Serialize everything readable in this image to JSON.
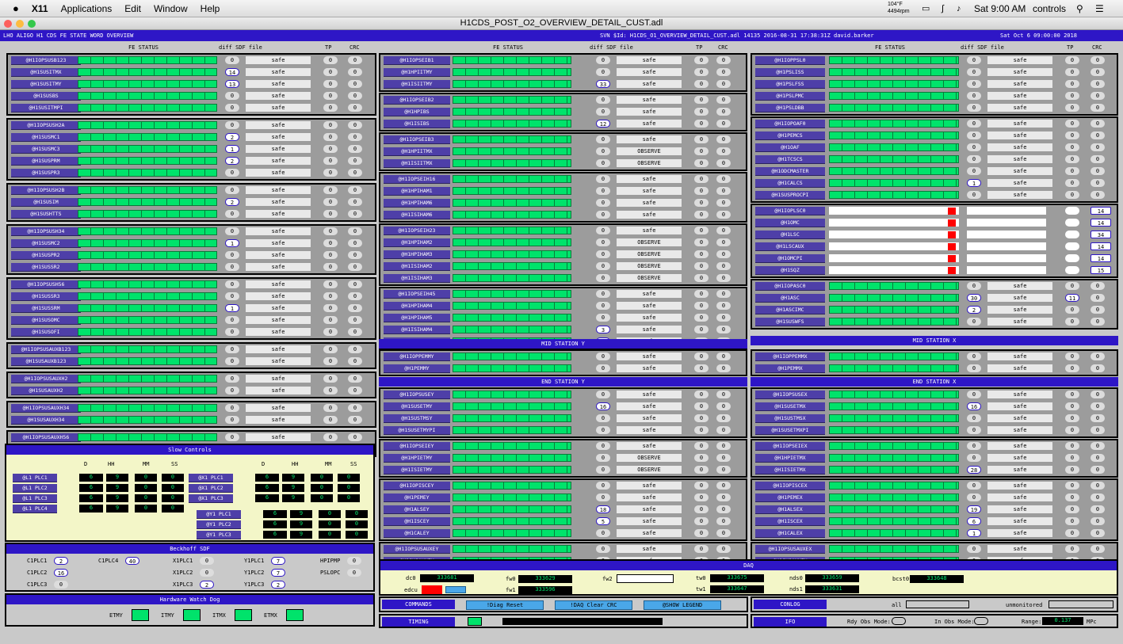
{
  "mac": {
    "apple": "",
    "app": "X11",
    "menus": [
      "Applications",
      "Edit",
      "Window",
      "Help"
    ],
    "temp": "104°F",
    "rpm": "4494rpm",
    "clock": "Sat 9:00 AM",
    "user": "controls"
  },
  "window": {
    "title": "H1CDS_POST_O2_OVERVIEW_DETAIL_CUST.adl"
  },
  "header": {
    "left": "LHO ALIGO H1 CDS FE STATE WORD OVERVIEW",
    "svn": "SVN $Id: H1CDS_O1_OVERVIEW_DETAIL_CUST.adl 14135 2016-08-31 17:38:31Z david.barker",
    "date": "Sat Oct  6 09:00:00 2018"
  },
  "cols": {
    "fe": "FE STATUS",
    "diff": "diff",
    "sdf": "SDF file",
    "tp": "TP",
    "crc": "CRC"
  },
  "left_blocks": [
    {
      "rows": [
        [
          "@H1IOPSUSB123",
          "0",
          "safe",
          "0",
          "0"
        ],
        [
          "@H1SUSITMX",
          "14",
          "safe",
          "0",
          "0"
        ],
        [
          "@H1SUSITMY",
          "13",
          "safe",
          "0",
          "0"
        ],
        [
          "@H1SUSBS",
          "0",
          "safe",
          "0",
          "0"
        ],
        [
          "@H1SUSITMPI",
          "0",
          "safe",
          "0",
          "0"
        ]
      ]
    },
    {
      "rows": [
        [
          "@H1IOPSUSH2A",
          "0",
          "safe",
          "0",
          "0"
        ],
        [
          "@H1SUSMC1",
          "2",
          "safe",
          "0",
          "0"
        ],
        [
          "@H1SUSMC3",
          "1",
          "safe",
          "0",
          "0"
        ],
        [
          "@H1SUSPRM",
          "2",
          "safe",
          "0",
          "0"
        ],
        [
          "@H1SUSPR3",
          "0",
          "safe",
          "0",
          "0"
        ]
      ]
    },
    {
      "rows": [
        [
          "@H1IOPSUSH2B",
          "0",
          "safe",
          "0",
          "0"
        ],
        [
          "@H1SUSIM",
          "2",
          "safe",
          "0",
          "0"
        ],
        [
          "@H1SUSHTTS",
          "0",
          "safe",
          "0",
          "0"
        ]
      ]
    },
    {
      "rows": [
        [
          "@H1IOPSUSH34",
          "0",
          "safe",
          "0",
          "0"
        ],
        [
          "@H1SUSMC2",
          "1",
          "safe",
          "0",
          "0"
        ],
        [
          "@H1SUSPR2",
          "0",
          "safe",
          "0",
          "0"
        ],
        [
          "@H1SUSSR2",
          "0",
          "safe",
          "0",
          "0"
        ]
      ]
    },
    {
      "rows": [
        [
          "@H1IOPSUSH56",
          "0",
          "safe",
          "0",
          "0"
        ],
        [
          "@H1SUSSR3",
          "0",
          "safe",
          "0",
          "0"
        ],
        [
          "@H1SUSSRM",
          "1",
          "safe",
          "0",
          "0"
        ],
        [
          "@H1SUSOMC",
          "0",
          "safe",
          "0",
          "0"
        ],
        [
          "@H1SUSOFI",
          "0",
          "safe",
          "0",
          "0"
        ]
      ]
    },
    {
      "rows": [
        [
          "@H1IOPSUSAUXB123",
          "0",
          "safe",
          "0",
          "0"
        ],
        [
          "@H1SUSAUXB123",
          "0",
          "safe",
          "0",
          "0"
        ]
      ]
    },
    {
      "rows": [
        [
          "@H1IOPSUSAUXH2",
          "0",
          "safe",
          "0",
          "0"
        ],
        [
          "@H1SUSAUXH2",
          "0",
          "safe",
          "0",
          "0"
        ]
      ]
    },
    {
      "rows": [
        [
          "@H1IOPSUSAUXH34",
          "0",
          "safe",
          "0",
          "0"
        ],
        [
          "@H1SUSAUXH34",
          "0",
          "safe",
          "0",
          "0"
        ]
      ]
    },
    {
      "rows": [
        [
          "@H1IOPSUSAUXH56",
          "0",
          "safe",
          "0",
          "0"
        ],
        [
          "@H1SUSAUXH56",
          "0",
          "safe",
          "0",
          "0"
        ]
      ]
    }
  ],
  "mid_blocks": [
    {
      "rows": [
        [
          "@H1IOPSEIB1",
          "0",
          "safe",
          "0",
          "0"
        ],
        [
          "@H1HPIITMY",
          "0",
          "safe",
          "0",
          "0"
        ],
        [
          "@H1ISIITMY",
          "33",
          "safe",
          "0",
          "0"
        ]
      ]
    },
    {
      "rows": [
        [
          "@H1IOPSEIB2",
          "0",
          "safe",
          "0",
          "0"
        ],
        [
          "@H1HPIBS",
          "0",
          "safe",
          "0",
          "0"
        ],
        [
          "@H1ISIBS",
          "12",
          "safe",
          "0",
          "0"
        ]
      ]
    },
    {
      "rows": [
        [
          "@H1IOPSEIB3",
          "0",
          "safe",
          "0",
          "0"
        ],
        [
          "@H1HPIITMX",
          "0",
          "OBSERVE",
          "0",
          "0"
        ],
        [
          "@H1ISIITMX",
          "0",
          "OBSERVE",
          "0",
          "0"
        ]
      ]
    },
    {
      "rows": [
        [
          "@H1IOPSEIH16",
          "0",
          "safe",
          "0",
          "0"
        ],
        [
          "@H1HPIHAM1",
          "0",
          "safe",
          "0",
          "0"
        ],
        [
          "@H1HPIHAM6",
          "0",
          "safe",
          "0",
          "0"
        ],
        [
          "@H1ISIHAM6",
          "0",
          "safe",
          "0",
          "0"
        ]
      ]
    },
    {
      "rows": [
        [
          "@H1IOPSEIH23",
          "0",
          "safe",
          "0",
          "0"
        ],
        [
          "@H1HPIHAM2",
          "0",
          "OBSERVE",
          "0",
          "0"
        ],
        [
          "@H1HPIHAM3",
          "0",
          "OBSERVE",
          "0",
          "0"
        ],
        [
          "@H1ISIHAM2",
          "0",
          "OBSERVE",
          "0",
          "0"
        ],
        [
          "@H1ISIHAM3",
          "0",
          "OBSERVE",
          "0",
          "0"
        ]
      ]
    },
    {
      "rows": [
        [
          "@H1IOPSEIH45",
          "0",
          "safe",
          "0",
          "0"
        ],
        [
          "@H1HPIHAM4",
          "0",
          "safe",
          "0",
          "0"
        ],
        [
          "@H1HPIHAM5",
          "0",
          "safe",
          "0",
          "0"
        ],
        [
          "@H1ISIHAM4",
          "3",
          "safe",
          "0",
          "0"
        ],
        [
          "@H1ISIHAM5",
          "5",
          "safe",
          "0",
          "0"
        ]
      ]
    }
  ],
  "right_blocks": [
    {
      "rows": [
        [
          "@H1IOPPSL0",
          "0",
          "safe",
          "0",
          "0"
        ],
        [
          "@H1PSLISS",
          "0",
          "safe",
          "0",
          "0"
        ],
        [
          "@H1PSLFSS",
          "0",
          "safe",
          "0",
          "0"
        ],
        [
          "@H1PSLPMC",
          "0",
          "safe",
          "0",
          "0"
        ],
        [
          "@H1PSLDBB",
          "0",
          "safe",
          "0",
          "0"
        ]
      ]
    },
    {
      "rows": [
        [
          "@H1IOPOAF0",
          "0",
          "safe",
          "0",
          "0"
        ],
        [
          "@H1PEMCS",
          "0",
          "safe",
          "0",
          "0"
        ],
        [
          "@H1OAF",
          "0",
          "safe",
          "0",
          "0"
        ],
        [
          "@H1TCSCS",
          "0",
          "safe",
          "0",
          "0"
        ],
        [
          "@H1ODCMASTER",
          "0",
          "safe",
          "0",
          "0"
        ],
        [
          "@H1CALCS",
          "1",
          "safe",
          "0",
          "0"
        ],
        [
          "@H1SUSPROCPI",
          "0",
          "safe",
          "0",
          "0"
        ]
      ]
    },
    {
      "rows": [
        [
          "@H1IOPLSC0",
          "",
          "",
          "",
          "14"
        ],
        [
          "@H1OMC",
          "",
          "",
          "",
          "14"
        ],
        [
          "@H1LSC",
          "",
          "",
          "",
          "34"
        ],
        [
          "@H1LSCAUX",
          "",
          "",
          "",
          "14"
        ],
        [
          "@H1OMCPI",
          "",
          "",
          "",
          "14"
        ],
        [
          "@H1SQZ",
          "",
          "",
          "",
          "15"
        ]
      ]
    },
    {
      "rows": [
        [
          "@H1IOPASC0",
          "0",
          "safe",
          "0",
          "0"
        ],
        [
          "@H1ASC",
          "30",
          "safe",
          "11",
          "0"
        ],
        [
          "@H1ASCIMC",
          "2",
          "safe",
          "0",
          "0"
        ],
        [
          "@H1SUSWFS",
          "0",
          "safe",
          "0",
          "0"
        ]
      ]
    }
  ],
  "mid_y": {
    "title": "MID STATION Y",
    "rows": [
      [
        "@H1IOPPEMMY",
        "0",
        "safe",
        "0",
        "0"
      ],
      [
        "@H1PEMMY",
        "0",
        "safe",
        "0",
        "0"
      ]
    ]
  },
  "mid_x": {
    "title": "MID STATION X",
    "rows": [
      [
        "@H1IOPPEMMX",
        "0",
        "safe",
        "0",
        "0"
      ],
      [
        "@H1PEMMX",
        "0",
        "safe",
        "0",
        "0"
      ]
    ]
  },
  "end_y": {
    "title": "END STATION Y",
    "blocks": [
      {
        "rows": [
          [
            "@H1IOPSUSEY",
            "0",
            "safe",
            "0",
            "0"
          ],
          [
            "@H1SUSETMY",
            "16",
            "safe",
            "0",
            "0"
          ],
          [
            "@H1SUSTMSY",
            "0",
            "safe",
            "0",
            "0"
          ],
          [
            "@H1SUSETMYPI",
            "0",
            "safe",
            "0",
            "0"
          ]
        ]
      },
      {
        "rows": [
          [
            "@H1IOPSEIEY",
            "0",
            "safe",
            "0",
            "0"
          ],
          [
            "@H1HPIETMY",
            "0",
            "OBSERVE",
            "0",
            "0"
          ],
          [
            "@H1ISIETMY",
            "0",
            "OBSERVE",
            "0",
            "0"
          ]
        ]
      },
      {
        "rows": [
          [
            "@H1IOPISCEY",
            "0",
            "safe",
            "0",
            "0"
          ],
          [
            "@H1PEMEY",
            "0",
            "safe",
            "0",
            "0"
          ],
          [
            "@H1ALSEY",
            "18",
            "safe",
            "0",
            "0"
          ],
          [
            "@H1ISCEY",
            "5",
            "safe",
            "0",
            "0"
          ],
          [
            "@H1CALEY",
            "0",
            "safe",
            "0",
            "0"
          ]
        ]
      },
      {
        "rows": [
          [
            "@H1IOPSUSAUXEY",
            "0",
            "safe",
            "0",
            "0"
          ],
          [
            "@H1SUSAUXEY",
            "0",
            "safe",
            "0",
            "0"
          ]
        ]
      }
    ]
  },
  "end_x": {
    "title": "END STATION X",
    "blocks": [
      {
        "rows": [
          [
            "@H1IOPSUSEX",
            "0",
            "safe",
            "0",
            "0"
          ],
          [
            "@H1SUSETMX",
            "16",
            "safe",
            "0",
            "0"
          ],
          [
            "@H1SUSTMSX",
            "0",
            "safe",
            "0",
            "0"
          ],
          [
            "@H1SUSETMXPI",
            "0",
            "safe",
            "0",
            "0"
          ]
        ]
      },
      {
        "rows": [
          [
            "@H1IOPSEIEX",
            "0",
            "safe",
            "0",
            "0"
          ],
          [
            "@H1HPIETMX",
            "0",
            "safe",
            "0",
            "0"
          ],
          [
            "@H1ISIETMX",
            "28",
            "safe",
            "0",
            "0"
          ]
        ]
      },
      {
        "rows": [
          [
            "@H1IOPISCEX",
            "0",
            "safe",
            "0",
            "0"
          ],
          [
            "@H1PEMEX",
            "0",
            "safe",
            "0",
            "0"
          ],
          [
            "@H1ALSEX",
            "19",
            "safe",
            "0",
            "0"
          ],
          [
            "@H1ISCEX",
            "6",
            "safe",
            "0",
            "0"
          ],
          [
            "@H1CALEX",
            "1",
            "safe",
            "0",
            "0"
          ]
        ]
      },
      {
        "rows": [
          [
            "@H1IOPSUSAUXEX",
            "0",
            "safe",
            "0",
            "0"
          ],
          [
            "@H1SUSAUXEX",
            "0",
            "safe",
            "0",
            "0"
          ]
        ]
      }
    ]
  },
  "slow": {
    "title": "Slow Controls",
    "hdr": [
      "D",
      "HH",
      "MM",
      "SS"
    ],
    "left": [
      [
        "@L1 PLC1",
        "6",
        "9",
        "0",
        "0"
      ],
      [
        "@L1 PLC2",
        "6",
        "9",
        "0",
        "0"
      ],
      [
        "@L1 PLC3",
        "6",
        "9",
        "0",
        "0"
      ],
      [
        "@L1 PLC4",
        "6",
        "9",
        "0",
        "0"
      ]
    ],
    "right": [
      [
        "@X1 PLC1",
        "6",
        "9",
        "0",
        "0"
      ],
      [
        "@X1 PLC2",
        "6",
        "9",
        "0",
        "0"
      ],
      [
        "@X1 PLC3",
        "6",
        "9",
        "0",
        "0"
      ],
      [
        "@Y1 PLC1",
        "6",
        "9",
        "0",
        "0"
      ],
      [
        "@Y1 PLC2",
        "6",
        "9",
        "0",
        "0"
      ],
      [
        "@Y1 PLC3",
        "6",
        "9",
        "0",
        "0"
      ]
    ]
  },
  "beckhoff": {
    "title": "Beckhoff SDF",
    "items": [
      [
        "C1PLC1",
        "2"
      ],
      [
        "C1PLC4",
        "40"
      ],
      [
        "X1PLC1",
        "0"
      ],
      [
        "Y1PLC1",
        "7"
      ],
      [
        "HPIPMP",
        "0"
      ],
      [
        "C1PLC2",
        "16"
      ],
      [
        "X1PLC2",
        "0"
      ],
      [
        "Y1PLC2",
        "7"
      ],
      [
        "PSLOPC",
        "0"
      ],
      [
        "C1PLC3",
        "0"
      ],
      [
        "X1PLC3",
        "2"
      ],
      [
        "Y1PLC3",
        "2"
      ]
    ]
  },
  "hwd": {
    "title": "Hardware Watch Dog",
    "labels": [
      "ETMY",
      "ITMY",
      "ITMX",
      "ETMX"
    ]
  },
  "daq": {
    "title": "DAQ",
    "dc0": "dc0",
    "dc0v": "333681",
    "edcu": "edcu",
    "fw0": "fw0",
    "fw0v": "333629",
    "fw1": "fw1",
    "fw1v": "333596",
    "fw2": "fw2",
    "tw0": "tw0",
    "tw0v": "333675",
    "tw1": "tw1",
    "tw1v": "333647",
    "nds0": "nds0",
    "nds0v": "333659",
    "nds1": "nds1",
    "nds1v": "333631",
    "bcst0": "bcst0",
    "bcst0v": "333648"
  },
  "commands": {
    "title": "COMMANDS",
    "b1": "!Diag Reset",
    "b2": "!DAQ Clear CRC",
    "b3": "@SHOW LEGEND"
  },
  "timing": {
    "title": "TIMING"
  },
  "conlog": {
    "title": "CONLOG",
    "all": "all",
    "unmon": "unmonitored"
  },
  "ifo": {
    "title": "IFO",
    "rdy": "Rdy Obs Mode:",
    "inobs": "In Obs Mode:",
    "range": "Range:",
    "rangev": "0.137",
    "unit": "MPc"
  }
}
